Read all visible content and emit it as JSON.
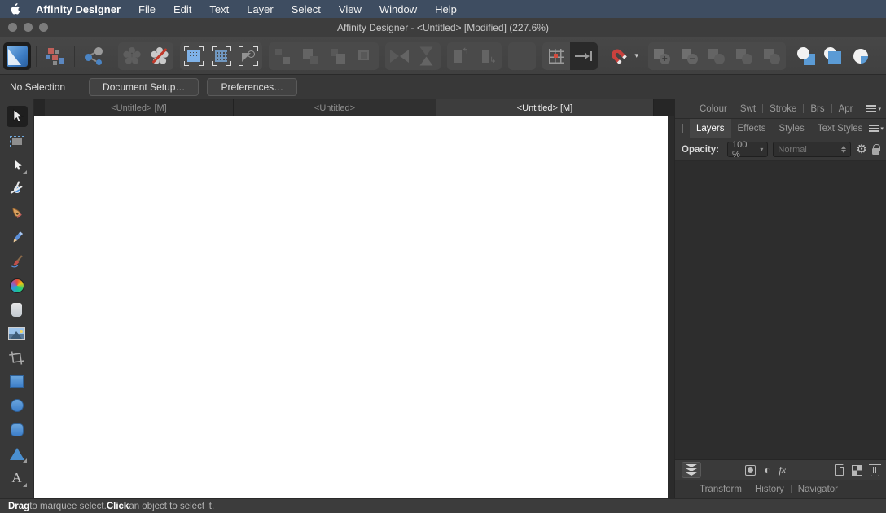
{
  "app": {
    "name": "Affinity Designer"
  },
  "menubar": {
    "apple_icon": "apple-logo",
    "items": [
      "File",
      "Edit",
      "Text",
      "Layer",
      "Select",
      "View",
      "Window",
      "Help"
    ]
  },
  "titlebar": {
    "title": "Affinity Designer - <Untitled> [Modified] (227.6%)"
  },
  "toolbar": {
    "icons": [
      "designer-persona",
      "pixel-persona",
      "export-persona",
      "defaults-synchronise",
      "defaults-revert",
      "pixel-grid",
      "pixel-grid-dotted",
      "convert-to-curves",
      "move-to-front",
      "move-forward",
      "move-backward",
      "move-to-back",
      "flip-horizontal",
      "flip-vertical",
      "rotate-anticlockwise",
      "rotate-clockwise",
      "alignment",
      "snapping-grid",
      "snapping-axis",
      "snapping-magnet",
      "snapping-options-caret",
      "boolean-add",
      "boolean-subtract",
      "boolean-intersect",
      "boolean-divide",
      "boolean-combine",
      "insert-behind",
      "insert-inside",
      "insert-on-top"
    ],
    "boolean_add_glyph": "+",
    "boolean_subtract_glyph": "−"
  },
  "context_bar": {
    "selection_status": "No Selection",
    "document_setup_label": "Document Setup…",
    "preferences_label": "Preferences…"
  },
  "document_tabs": [
    {
      "label": "<Untitled> [M]",
      "active": false
    },
    {
      "label": "<Untitled>",
      "active": false
    },
    {
      "label": "<Untitled> [M]",
      "active": true
    }
  ],
  "tools": [
    "move-tool",
    "artboard-tool",
    "node-tool",
    "point-transform-tool",
    "pen-tool",
    "pencil-tool",
    "vector-brush-tool",
    "colour-picker-tool",
    "transparency-tool",
    "place-image-tool",
    "vector-crop-tool",
    "rectangle-tool",
    "ellipse-tool",
    "rounded-rectangle-tool",
    "triangle-tool",
    "artistic-text-tool"
  ],
  "right_panel": {
    "studio_tabs": [
      "Colour",
      "Swt",
      "Stroke",
      "Brs",
      "Apr"
    ],
    "layer_tabs": [
      "Layers",
      "Effects",
      "Styles",
      "Text Styles"
    ],
    "active_layer_tab": "Layers",
    "opacity_label": "Opacity:",
    "opacity_value": "100 %",
    "blend_mode": "Normal",
    "bottom_tabs": [
      "Transform",
      "History",
      "Navigator"
    ]
  },
  "statusbar": {
    "segments": [
      {
        "text": "Drag",
        "bold": true
      },
      {
        "text": " to marquee select. ",
        "bold": false
      },
      {
        "text": "Click",
        "bold": true
      },
      {
        "text": " an object to select it.",
        "bold": false
      }
    ]
  },
  "icon_glyphs": {
    "text_tool": "A",
    "gear": "⚙",
    "adjustment": "◐",
    "fx": "fx",
    "caret_down": "▾",
    "rotate_ccw": "↰",
    "rotate_cw": "↳",
    "arrow_up": "↑"
  },
  "colors": {
    "menubar": "#3e4d61",
    "accent_blue": "#4a90d9",
    "magnet_red": "#c9413d",
    "canvas": "#ffffff",
    "panel": "#333333"
  }
}
